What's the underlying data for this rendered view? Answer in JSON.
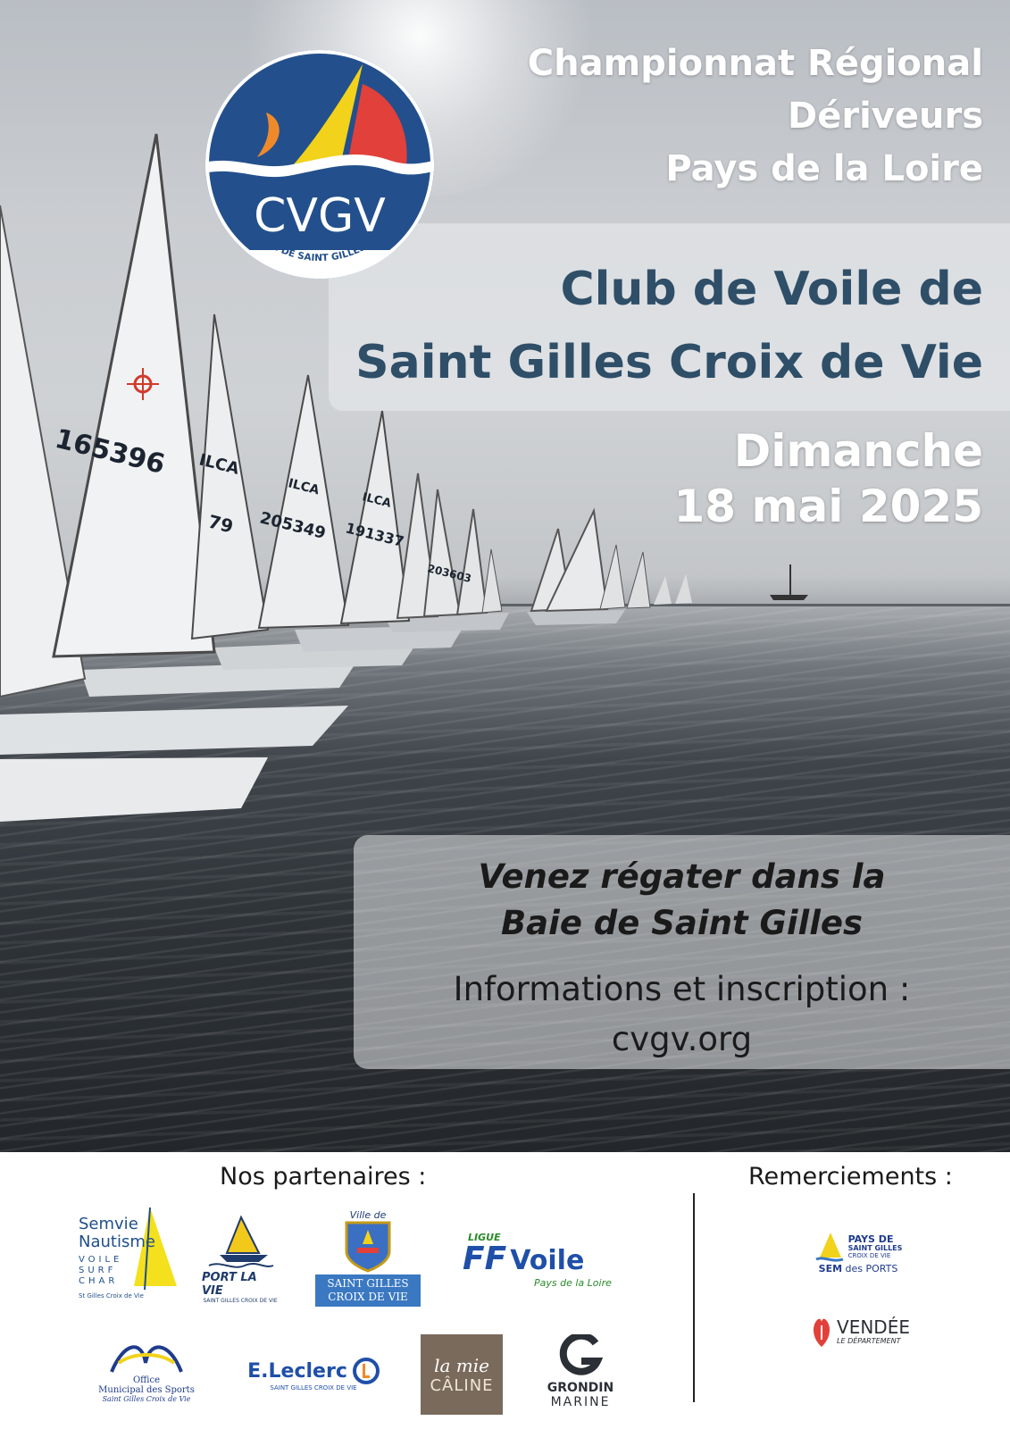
{
  "poster": {
    "championship_line1": "Championnat Régional",
    "championship_line2": "Dériveurs",
    "championship_line3": "Pays de la Loire",
    "club_line1": "Club de Voile de",
    "club_line2": "Saint Gilles Croix de Vie",
    "date_line1": "Dimanche",
    "date_line2": "18 mai 2025",
    "invite_line1": "Venez régater dans la",
    "invite_line2": "Baie de Saint Gilles",
    "info_line1": "Informations et inscription :",
    "info_line2": "cvgv.org"
  },
  "logo": {
    "initials": "CVGV",
    "ring_text": "CLUB DE VOILE DE SAINT GILLES CROIX DE VIE",
    "colors": {
      "navy": "#23508c",
      "yellow": "#f2d21a",
      "red": "#e2403a",
      "orange": "#ef8a2a",
      "white": "#ffffff"
    }
  },
  "sail_numbers": [
    "165396",
    "ILCA",
    "79",
    "205349",
    "ILCA",
    "191337",
    "ILCA",
    "203603"
  ],
  "footer": {
    "partners_title": "Nos partenaires :",
    "thanks_title": "Remerciements :",
    "partners": {
      "semvie": {
        "line1": "Semvie",
        "line2": "Nautisme",
        "line3": "VOILE",
        "line4": "SURF",
        "line5": "CHAR",
        "line6": "St Gilles Croix de Vie"
      },
      "portlavie": {
        "name": "PORT LA VIE",
        "sub": "SAINT GILLES CROIX DE VIE"
      },
      "sgcv": {
        "top": "Ville de",
        "line1": "SAINT GILLES",
        "line2": "CROIX DE VIE"
      },
      "ffvoile": {
        "ligue": "LIGUE",
        "ff": "FF",
        "voile": "Voile",
        "region": "Pays de la Loire"
      },
      "oms": {
        "line1": "Office",
        "line2": "Municipal des Sports",
        "line3": "Saint Gilles Croix de Vie"
      },
      "leclerc": {
        "name": "E.Leclerc",
        "sub": "SAINT GILLES CROIX DE VIE"
      },
      "lamie": {
        "line1": "la mie",
        "line2": "CÂLINE"
      },
      "grondin": {
        "line1": "GRONDIN",
        "line2": "MARINE"
      }
    },
    "thanks": {
      "paysdesg": {
        "line1": "PAYS DE",
        "line2": "SAINT GILLES",
        "line3": "CROIX DE VIE",
        "sem": "SEM",
        "ports": "des PORTS"
      },
      "vendee": {
        "name": "VENDÉE",
        "sub": "LE DÉPARTEMENT"
      }
    }
  }
}
